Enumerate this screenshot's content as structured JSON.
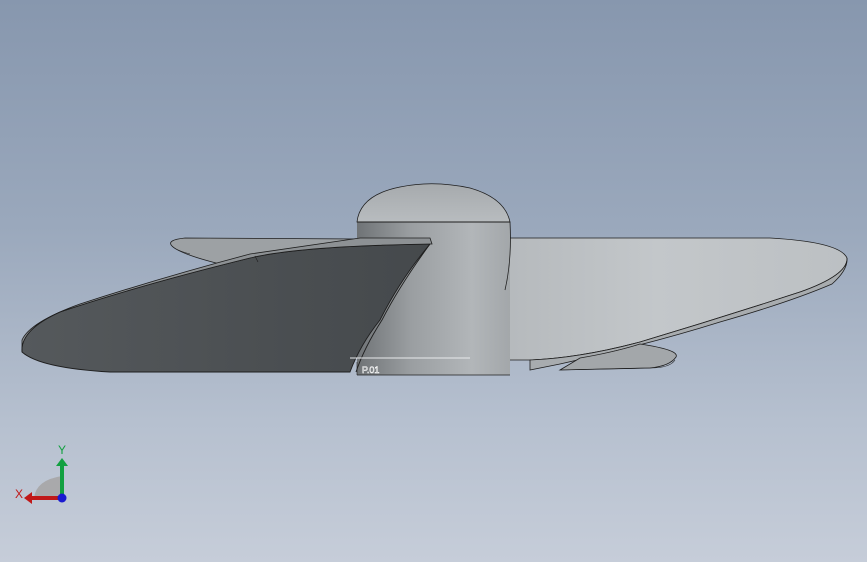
{
  "viewport": {
    "background_top": "#8797ae",
    "background_bottom": "#c6cdd9"
  },
  "model": {
    "engraved_text": "P.01",
    "colors": {
      "dark_blade": "#4f5356",
      "light_blade": "#bcc0c3",
      "hub": "#a7abae",
      "edge_stroke": "#1e1e1e"
    }
  },
  "triad": {
    "x_label": "X",
    "y_label": "Y",
    "x_color": "#c01818",
    "y_color": "#12a040",
    "z_color": "#1a1ad0"
  }
}
